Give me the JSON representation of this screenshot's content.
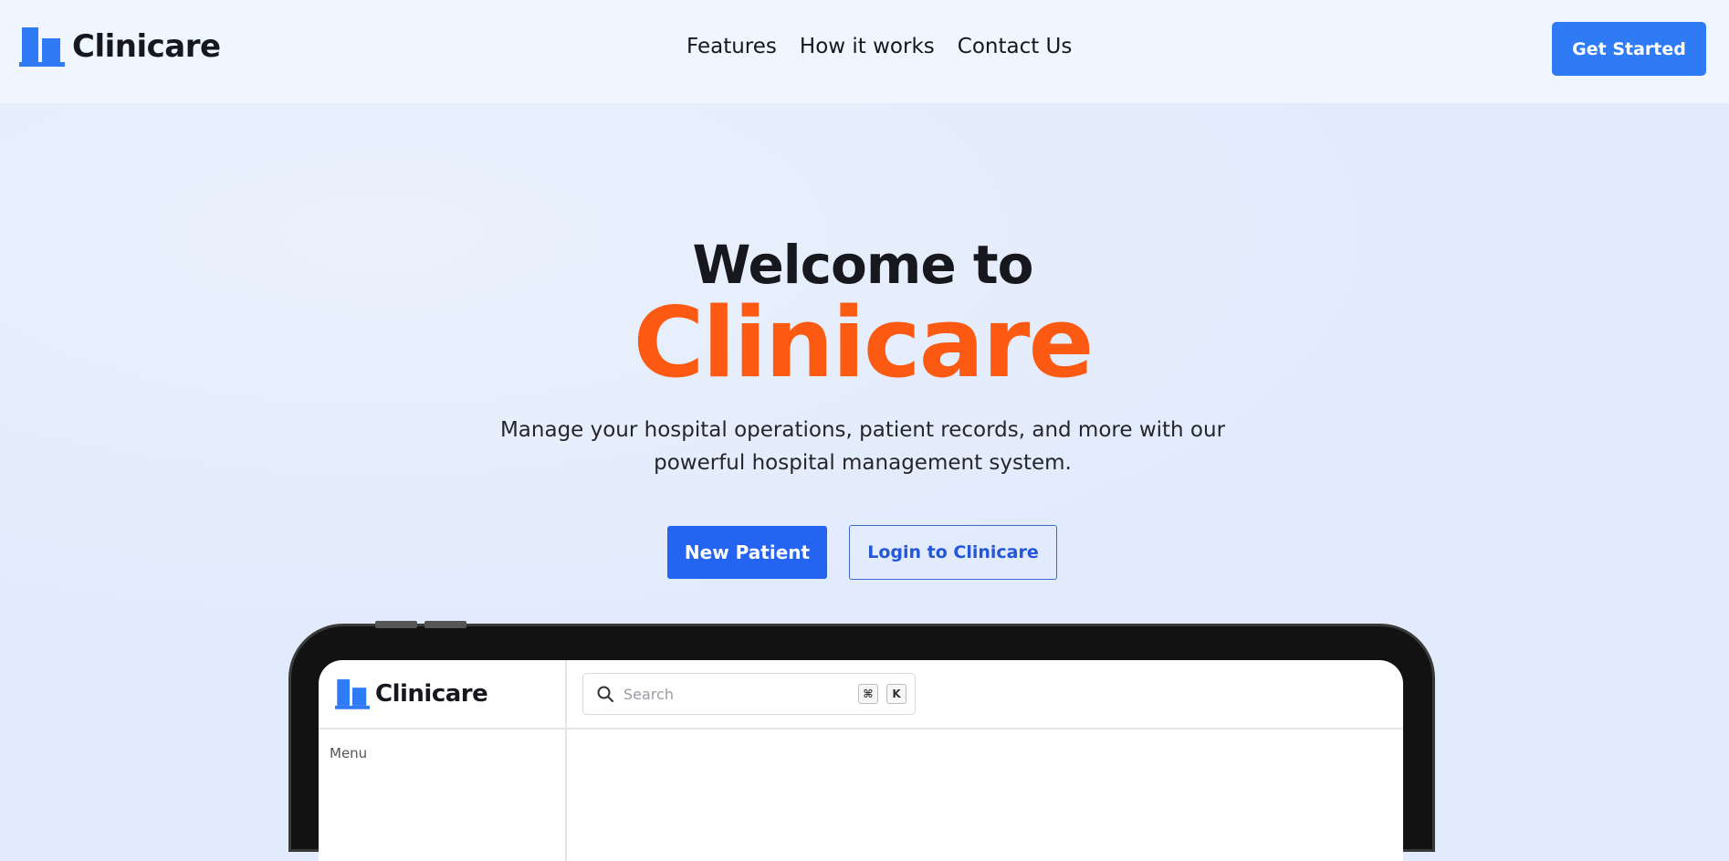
{
  "brand": {
    "name": "Clinicare",
    "logo_icon": "building-icon",
    "logo_color": "#2f7bf6"
  },
  "nav": {
    "links": [
      {
        "label": "Features"
      },
      {
        "label": "How it works"
      },
      {
        "label": "Contact Us"
      }
    ],
    "cta_label": "Get Started"
  },
  "hero": {
    "heading": "Welcome to",
    "brand_word": "Clinicare",
    "subtitle": "Manage your hospital operations, patient records, and more with our powerful hospital management system.",
    "primary_button": "New Patient",
    "secondary_button": "Login to Clinicare"
  },
  "preview": {
    "brand_name": "Clinicare",
    "search_placeholder": "Search",
    "shortcut_keys": [
      "⌘",
      "K"
    ],
    "menu_label": "Menu"
  },
  "colors": {
    "accent_blue": "#2563f1",
    "cta_blue": "#2f7bf6",
    "brand_orange": "#fc5a12",
    "hero_bg": "#e2ebfc",
    "nav_bg": "#f0f6ff",
    "text_dark": "#16181d"
  }
}
